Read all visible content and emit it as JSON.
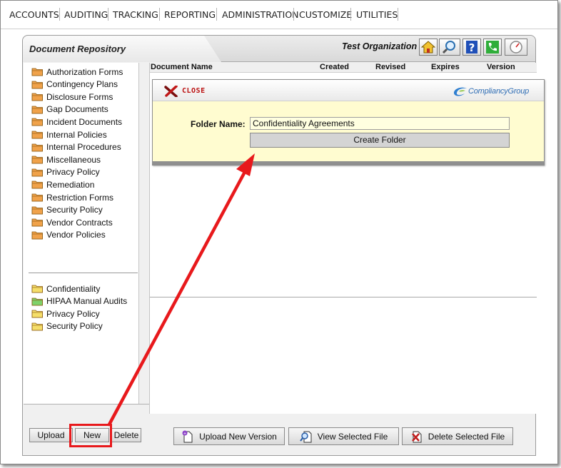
{
  "nav": {
    "items": [
      "ACCOUNTS",
      "AUDITING",
      "TRACKING",
      "REPORTING",
      "ADMINISTRATION",
      "CUSTOMIZE",
      "UTILITIES"
    ]
  },
  "panel": {
    "title": "Document Repository",
    "organization": "Test Organization",
    "header_icons": [
      "home-icon",
      "search-icon",
      "help-icon",
      "phone-icon",
      "gauge-icon"
    ]
  },
  "folders": {
    "primary": [
      "Authorization Forms",
      "Contingency Plans",
      "Disclosure Forms",
      "Gap Documents",
      "Incident Documents",
      "Internal Policies",
      "Internal Procedures",
      "Miscellaneous",
      "Privacy Policy",
      "Remediation",
      "Restriction Forms",
      "Security Policy",
      "Vendor Contracts",
      "Vendor Policies"
    ],
    "secondary": [
      "Confidentiality",
      "HIPAA Manual Audits",
      "Privacy Policy",
      "Security Policy"
    ],
    "colors": {
      "orange": "#f0a24a",
      "yellow": "#f5de6a",
      "green": "#7ed26a"
    }
  },
  "table": {
    "columns": [
      "Document Name",
      "Created",
      "Revised",
      "Expires",
      "Version"
    ]
  },
  "modal": {
    "close_label": "CLOSE",
    "brand": "CompliancyGroup",
    "folder_label": "Folder Name:",
    "folder_value": "Confidentiality Agreements",
    "create_button": "Create Folder"
  },
  "left_toolbar": {
    "upload": "Upload",
    "new": "New",
    "delete": "Delete"
  },
  "doc_toolbar": {
    "upload_version": "Upload New Version",
    "view_file": "View Selected File",
    "delete_file": "Delete Selected File"
  },
  "annotation": {
    "color": "#e8191c"
  }
}
